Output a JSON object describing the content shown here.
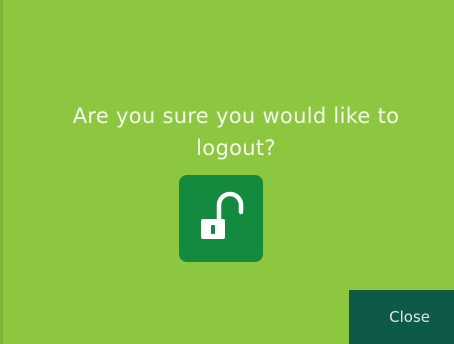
{
  "dialog": {
    "message_line1": "Are you sure you would like to",
    "message_line2": "logout?",
    "logout_icon": "unlock-icon",
    "close_label": "Close"
  },
  "colors": {
    "background": "#8dc63f",
    "icon_button": "#138a3d",
    "close_button": "#0c5a47",
    "text": "#f4f9ec"
  }
}
